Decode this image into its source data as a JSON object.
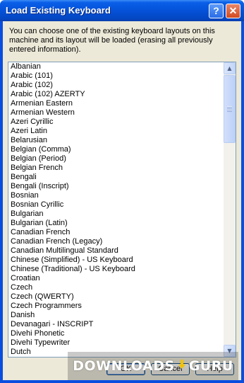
{
  "window": {
    "title": "Load Existing Keyboard",
    "help_glyph": "?",
    "close_glyph": "✕"
  },
  "description": "You can choose one of the existing  keyboard layouts on this machine and its layout will be loaded (erasing all previously entered information).",
  "keyboards": [
    "Albanian",
    "Arabic (101)",
    "Arabic (102)",
    "Arabic (102) AZERTY",
    "Armenian Eastern",
    "Armenian Western",
    "Azeri Cyrillic",
    "Azeri Latin",
    "Belarusian",
    "Belgian (Comma)",
    "Belgian (Period)",
    "Belgian French",
    "Bengali",
    "Bengali (Inscript)",
    "Bosnian",
    "Bosnian Cyrillic",
    "Bulgarian",
    "Bulgarian (Latin)",
    "Canadian French",
    "Canadian French (Legacy)",
    "Canadian Multilingual Standard",
    "Chinese (Simplified) - US Keyboard",
    "Chinese (Traditional) - US Keyboard",
    "Croatian",
    "Czech",
    "Czech (QWERTY)",
    "Czech Programmers",
    "Danish",
    "Devanagari - INSCRIPT",
    "Divehi Phonetic",
    "Divehi Typewriter",
    "Dutch"
  ],
  "scrollbar": {
    "up_icon": "chevron-up-icon",
    "down_icon": "chevron-down-icon",
    "up_glyph": "▲",
    "down_glyph": "▼"
  },
  "buttons": {
    "ok": "OK",
    "cancel": "Cancel",
    "help": "Help"
  },
  "watermark": {
    "left": "DOWNLOADS",
    "right": "GURU"
  },
  "colors": {
    "title_bar": "#0552d8",
    "dialog_face": "#ece9d8",
    "watermark_mark": "#f2c200"
  }
}
